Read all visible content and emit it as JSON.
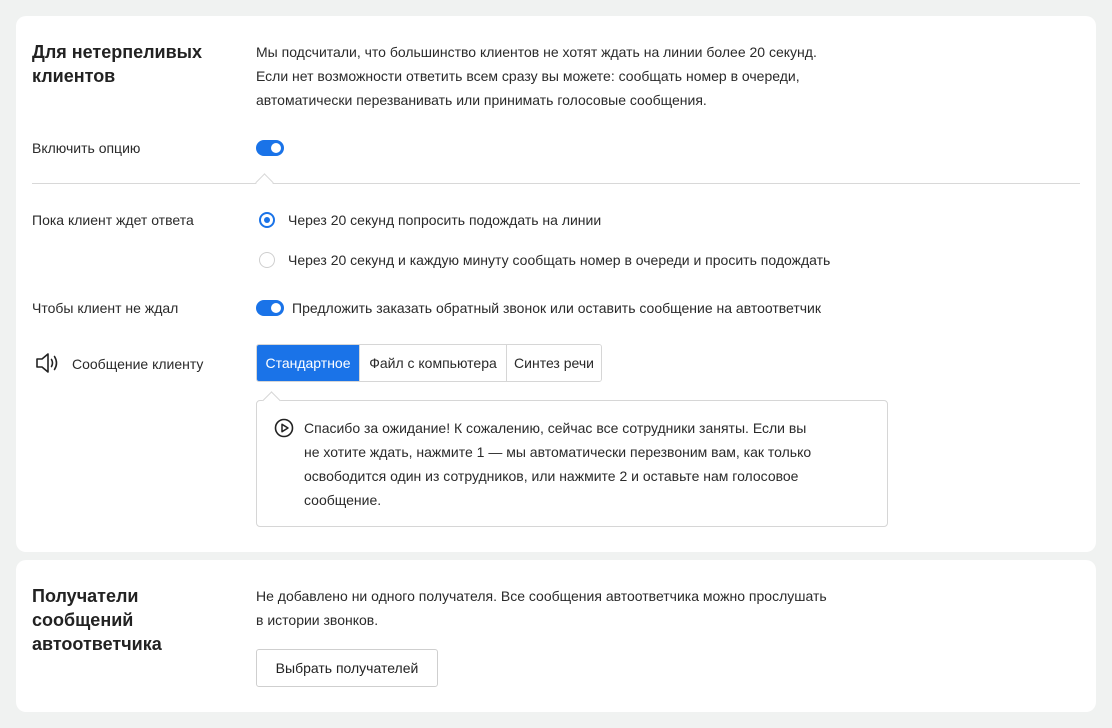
{
  "section_impatient": {
    "title_line1": "Для нетерпеливых",
    "title_line2": "клиентов",
    "description": [
      "Мы подсчитали, что большинство клиентов не хотят ждать на линии более 20 секунд.",
      "Если нет возможности ответить всем сразу вы можете: сообщать номер в очереди,",
      "автоматически перезванивать или принимать голосовые сообщения."
    ],
    "enable_label": "Включить опцию",
    "enable_on": true,
    "waiting_label": "Пока клиент ждет ответа",
    "waiting_options": [
      {
        "label": "Через 20 секунд попросить подождать на линии",
        "selected": true
      },
      {
        "label": "Через 20 секунд и каждую минуту сообщать номер в очереди и просить подождать",
        "selected": false
      }
    ],
    "no_wait_label": "Чтобы клиент не ждал",
    "callback_toggle_label": "Предложить заказать обратный звонок или оставить сообщение на автоответчик",
    "callback_on": true,
    "message_label": "Сообщение клиенту",
    "message_icon": "speaker-icon",
    "message_tabs": [
      "Стандартное",
      "Файл с компьютера",
      "Синтез речи"
    ],
    "message_tab_active": 0,
    "message_text": [
      "Спасибо за ожидание! К сожалению, сейчас все сотрудники заняты. Если вы",
      "не хотите ждать, нажмите 1 — мы автоматически перезвоним вам, как только",
      "освободится один из сотрудников, или нажмите 2 и оставьте нам голосовое",
      "сообщение."
    ]
  },
  "section_recipients": {
    "title_line1": "Получатели",
    "title_line2": "сообщений",
    "title_line3": "автоответчика",
    "description": [
      "Не добавлено ни одного получателя. Все сообщения автоответчика можно прослушать",
      "в истории звонков."
    ],
    "select_button": "Выбрать получателей"
  },
  "colors": {
    "accent": "#1a73e8",
    "background": "#f0f2f1",
    "card": "#ffffff",
    "border": "#d6d6d6"
  }
}
